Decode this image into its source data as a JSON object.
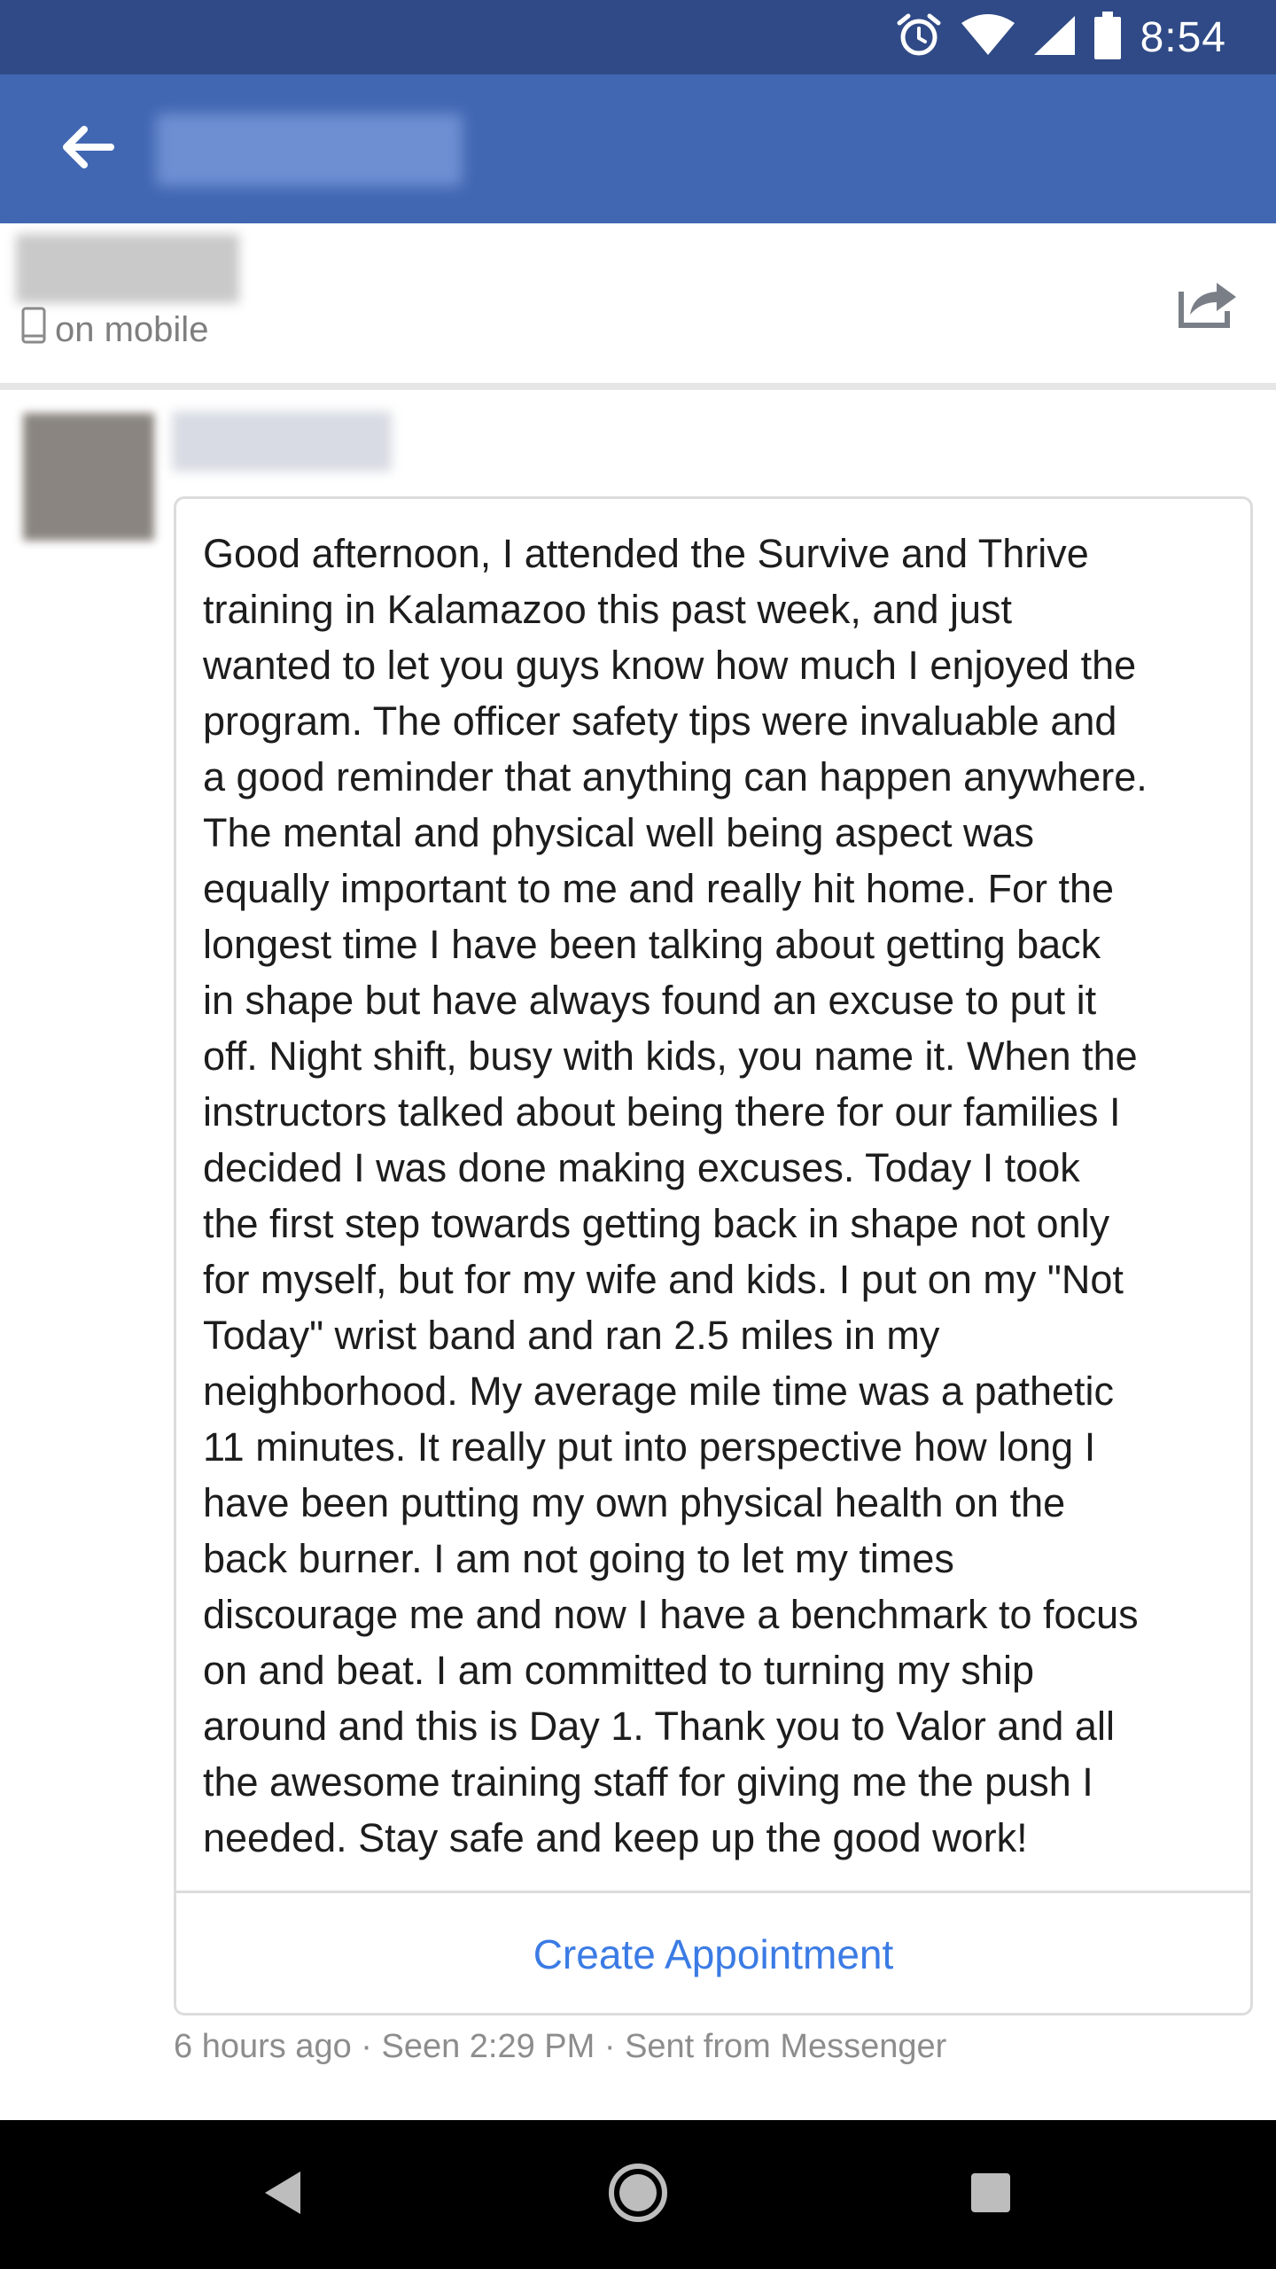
{
  "status_bar": {
    "time": "8:54",
    "icons": [
      "alarm-icon",
      "wifi-icon",
      "signal-icon",
      "battery-icon"
    ]
  },
  "app_bar": {
    "back_icon": "arrow-left-icon",
    "title_blurred": true
  },
  "conversation_header": {
    "status_text": "on mobile",
    "status_icon": "phone-icon",
    "share_icon": "share-icon"
  },
  "message": {
    "lines": [
      "Good afternoon, I attended the Survive and Thrive",
      "training in Kalamazoo this past week, and just",
      "wanted to let you guys know how much I enjoyed the",
      "program. The officer safety tips were invaluable and",
      "a good reminder that anything can happen anywhere.",
      "The mental and physical well being aspect was",
      "equally important to me and really hit home. For the",
      "longest time I have been talking about getting back",
      "in shape but have always found an excuse to put it",
      "off. Night shift, busy with kids, you name it. When the",
      "instructors talked about being there for our families I",
      "decided I was done making excuses. Today I took",
      "the first step towards getting back in shape not only",
      "for myself, but for my wife and kids. I put on my \"Not",
      "Today\" wrist band and ran 2.5 miles in my",
      "neighborhood. My average mile time was a pathetic",
      "11 minutes. It really put into perspective how long I",
      "have been putting my own physical health on the",
      "back burner. I am not going to let my times",
      "discourage me and now I have a benchmark to focus",
      "on and beat. I am committed to turning my ship",
      "around and this is Day 1. Thank you to Valor and all",
      "the awesome training staff for giving me the push I",
      "needed. Stay safe and keep up the good work!"
    ],
    "action_label": "Create Appointment",
    "meta": "6 hours ago · Seen 2:29 PM · Sent from Messenger"
  },
  "nav_bar": {
    "icons": [
      "nav-back-icon",
      "nav-home-icon",
      "nav-recents-icon"
    ]
  },
  "colors": {
    "status_bar": "#2f4a86",
    "app_bar": "#4267b2",
    "link": "#3b7be4"
  }
}
